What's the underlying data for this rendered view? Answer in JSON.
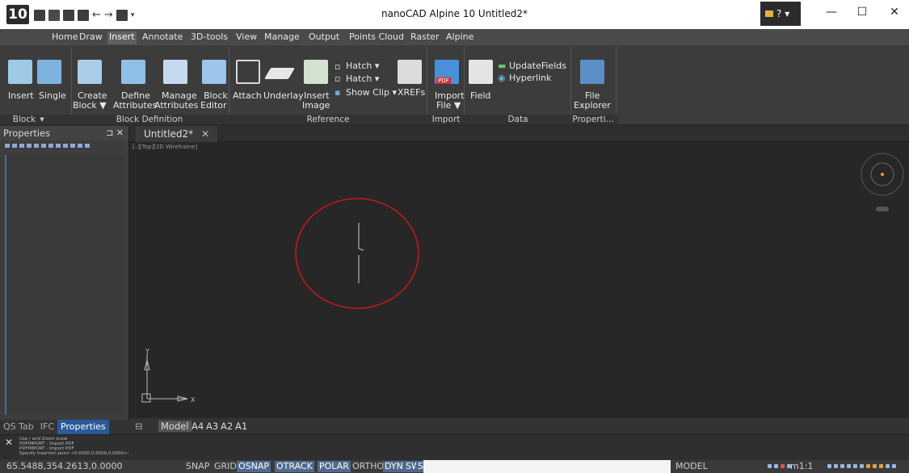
{
  "app": {
    "logo": "10",
    "title": "nanoCAD Alpine 10 Untitled2*",
    "help_label": "?",
    "controls": {
      "minimize": "—",
      "maximize": "☐",
      "close": "✕"
    }
  },
  "menu": {
    "tabs": [
      "Home",
      "Draw",
      "Insert",
      "Annotate",
      "3D-tools",
      "View",
      "Manage",
      "Output",
      "Points Cloud",
      "Raster",
      "Alpine"
    ],
    "active": "Insert"
  },
  "ribbon": {
    "buttons": {
      "insert": "Insert",
      "single": "Single",
      "create_block": "Create",
      "create_block_2": "Block ▼",
      "define_attr": "Define",
      "define_attr_2": "Attributes",
      "manage_attr": "Manage",
      "manage_attr_2": "Attributes",
      "block_editor": "Block",
      "block_editor_2": "Editor",
      "attach": "Attach",
      "underlay": "Underlay",
      "insert_image": "Insert",
      "insert_image_2": "Image",
      "hatch1": "Hatch ▾",
      "hatch2": "Hatch ▾",
      "show_clip": "Show Clip ▾",
      "xrefs": "XREFs",
      "import_file": "Import",
      "import_file_2": "File ▼",
      "field": "Field",
      "update_fields": "UpdateFields",
      "hyperlink": "Hyperlink",
      "file_explorer": "File",
      "file_explorer_2": "Explorer",
      "pdf_badge": "PDF"
    },
    "panels": {
      "block": "Block",
      "block_definition": "Block Definition",
      "reference": "Reference",
      "import": "Import",
      "data": "Data",
      "properties": "Properti..."
    }
  },
  "properties_panel": {
    "title": "Properties",
    "pin": "⊐ ✕",
    "tabs": [
      "QS Tab",
      "IFC",
      "Properties"
    ],
    "active_tab": "Properties"
  },
  "document": {
    "tab_label": "Untitled2*",
    "close": "✕"
  },
  "layout_tabs": {
    "tabs": [
      "Model",
      "A4",
      "A3",
      "A2",
      "A1"
    ],
    "active": "Model"
  },
  "command": {
    "close": "✕",
    "lines": [
      "Use / and Zoom scale",
      "PDFIMPORT - Import PDF",
      "PDFIMPORT - Import PDF",
      "Specify insertion point <0.0000,0.0000,0.0000>:"
    ]
  },
  "status": {
    "coords": "65.5488,354.2613,0.0000",
    "flags": [
      {
        "label": "SNAP",
        "on": false
      },
      {
        "label": "GRID",
        "on": false
      },
      {
        "label": "OSNAP",
        "on": true
      },
      {
        "label": "OTRACK",
        "on": true
      },
      {
        "label": "POLAR",
        "on": true
      },
      {
        "label": "ORTHO",
        "on": false
      },
      {
        "label": "DYN",
        "on": true
      },
      {
        "label": "SW",
        "on": true
      },
      {
        "label": "SH",
        "on": true
      }
    ],
    "model": "MODEL",
    "scale": "m1:1"
  },
  "canvas": {
    "axis_x": "X",
    "axis_y": "Y",
    "highlight_color": "#d01818"
  }
}
